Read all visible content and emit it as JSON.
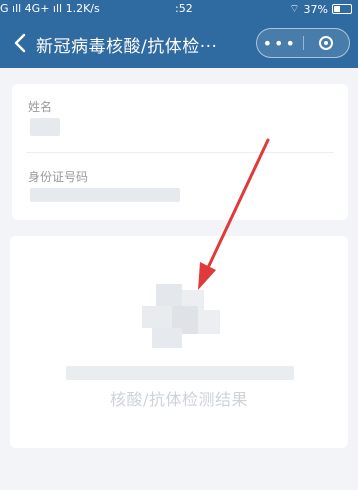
{
  "status_bar": {
    "network": "G ıll 4G+ ıll 1.2K/s",
    "time": ":52",
    "battery": "37%"
  },
  "nav": {
    "title": "新冠病毒核酸/抗体检···",
    "more_label": "•••"
  },
  "form": {
    "name_label": "姓名",
    "id_label": "身份证号码"
  },
  "result": {
    "title": "核酸/抗体检测结果"
  },
  "colors": {
    "header": "#2f6aa0",
    "arrow": "#e03a3a"
  }
}
